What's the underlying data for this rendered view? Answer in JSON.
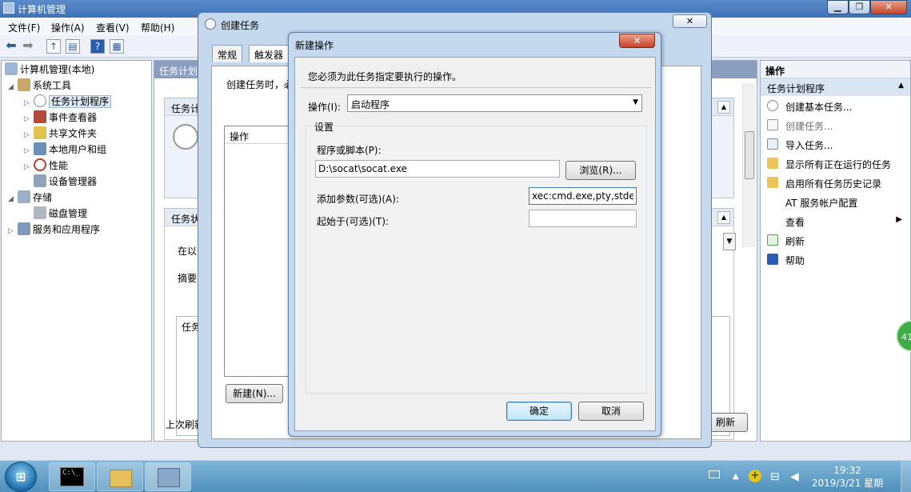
{
  "main_window": {
    "title": "计算机管理",
    "minimize": "▁",
    "maximize": "❐",
    "close": "✕",
    "menu": [
      "文件(F)",
      "操作(A)",
      "查看(V)",
      "帮助(H)"
    ]
  },
  "tree": {
    "root": "计算机管理(本地)",
    "system_tools": "系统工具",
    "task_scheduler": "任务计划程序",
    "event_viewer": "事件查看器",
    "shared_folders": "共享文件夹",
    "local_users": "本地用户和组",
    "performance": "性能",
    "device_manager": "设备管理器",
    "storage": "存储",
    "disk_mgmt": "磁盘管理",
    "services_apps": "服务和应用程序"
  },
  "mid": {
    "header": "任务计划",
    "g1_title": "任务计",
    "g2_title": "任务状",
    "text1": "在以",
    "text2": "摘要",
    "g3_header": "任务名",
    "bottom": "上次刷新",
    "refresh_btn": "刷新",
    "cancel_btn": "消"
  },
  "actions": {
    "header": "操作",
    "section": "任务计划程序",
    "items": [
      "创建基本任务...",
      "创建任务...",
      "导入任务...",
      "显示所有正在运行的任务",
      "启用所有任务历史记录",
      "AT 服务帐户配置",
      "查看",
      "刷新",
      "帮助"
    ]
  },
  "create_task": {
    "title": "创建任务",
    "tabs": [
      "常规",
      "触发器"
    ],
    "desc": "创建任务时，必",
    "list_header": "操作",
    "new_button": "新建(N)..."
  },
  "new_action": {
    "title": "新建操作",
    "description": "您必须为此任务指定要执行的操作。",
    "action_label": "操作(I):",
    "action_value": "启动程序",
    "settings_label": "设置",
    "program_label": "程序或脚本(P):",
    "program_value": "D:\\socat\\socat.exe",
    "browse_button": "浏览(R)...",
    "args_label": "添加参数(可选)(A):",
    "args_value": "xec:cmd.exe,pty,stderr",
    "start_in_label": "起始于(可选)(T):",
    "start_in_value": "",
    "ok_button": "确定",
    "cancel_button": "取消"
  },
  "taskbar": {
    "time": "19:32",
    "date": "2019/3/21 星期四",
    "cmd_label": "C:\\_"
  },
  "badge": {
    "text": "41"
  },
  "colors": {
    "accent": "#3d72b8",
    "selection": "#dde8f5"
  }
}
